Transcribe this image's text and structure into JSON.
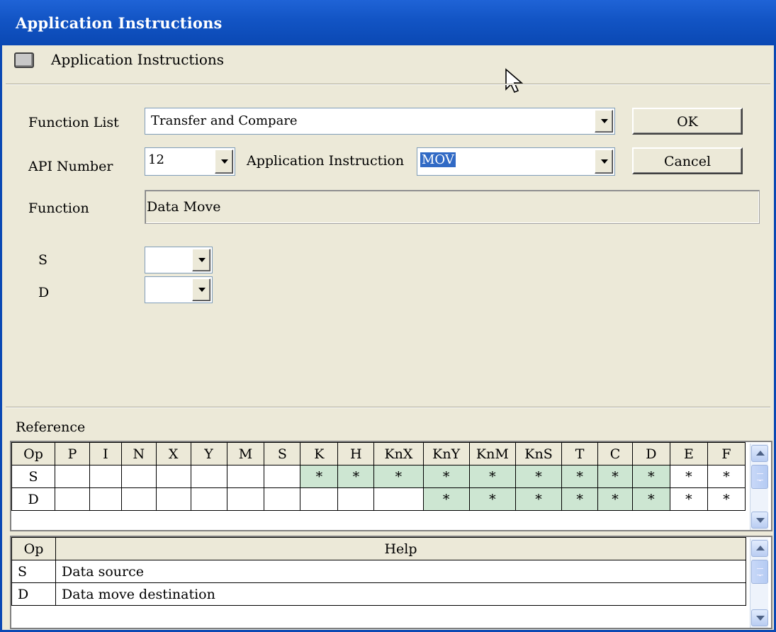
{
  "window": {
    "title": "Application Instructions"
  },
  "header": {
    "label": "Application Instructions"
  },
  "form": {
    "function_list_label": "Function List",
    "function_list_value": "Transfer and Compare",
    "api_number_label": "API Number",
    "api_number_value": "12",
    "app_instruction_label": "Application Instruction",
    "app_instruction_value": "MOV",
    "function_label": "Function",
    "function_value": "Data Move",
    "s_label": "S",
    "s_value": "",
    "d_label": "D",
    "d_value": ""
  },
  "buttons": {
    "ok": "OK",
    "cancel": "Cancel"
  },
  "reference": {
    "label": "Reference",
    "columns": [
      "Op",
      "P",
      "I",
      "N",
      "X",
      "Y",
      "M",
      "S",
      "K",
      "H",
      "KnX",
      "KnY",
      "KnM",
      "KnS",
      "T",
      "C",
      "D",
      "E",
      "F"
    ],
    "rows": [
      {
        "op": "S",
        "cells": [
          "",
          "",
          "",
          "",
          "",
          "",
          "",
          "*",
          "*",
          "*",
          "*",
          "*",
          "*",
          "*",
          "*",
          "*",
          "*",
          "*"
        ]
      },
      {
        "op": "D",
        "cells": [
          "",
          "",
          "",
          "",
          "",
          "",
          "",
          "",
          "",
          "",
          "*",
          "*",
          "*",
          "*",
          "*",
          "*",
          "*",
          "*"
        ]
      }
    ],
    "highlight_color": "#cde6d2"
  },
  "help": {
    "columns": [
      "Op",
      "Help"
    ],
    "rows": [
      {
        "op": "S",
        "text": "Data source"
      },
      {
        "op": "D",
        "text": "Data move destination"
      }
    ]
  },
  "colors": {
    "titlebar": "#0a48b3",
    "selection": "#316ac5",
    "window_bg": "#ece9d8"
  }
}
